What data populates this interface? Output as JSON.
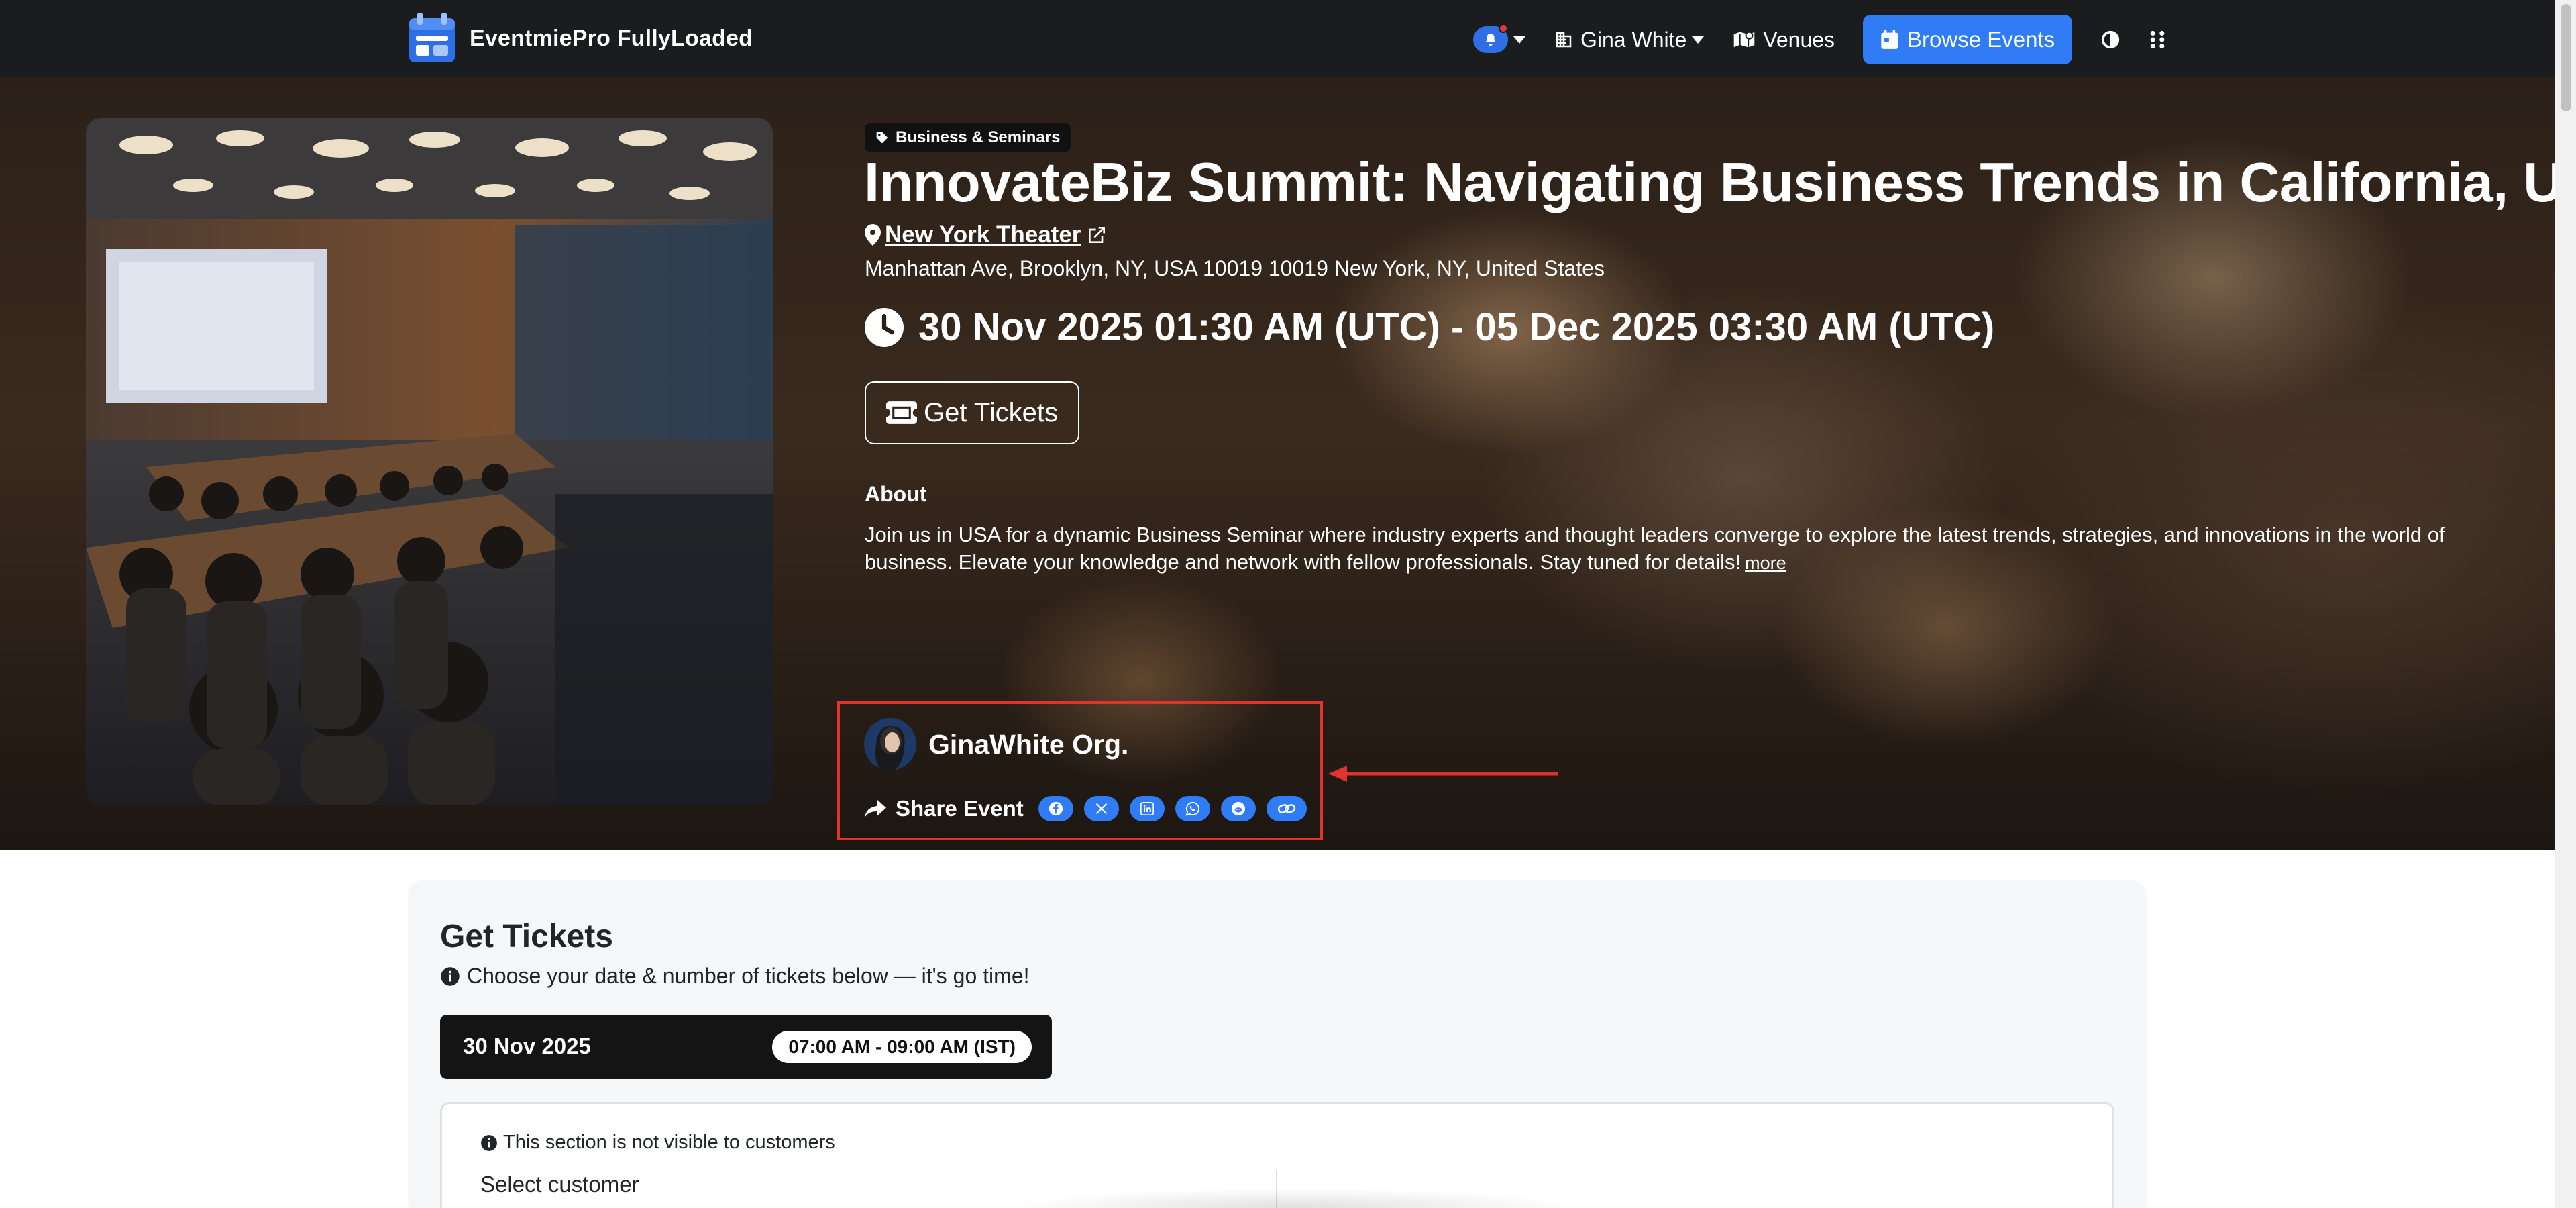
{
  "navbar": {
    "brand": "EventmiePro FullyLoaded",
    "user_name": "Gina White",
    "venues_label": "Venues",
    "browse_label": "Browse Events"
  },
  "event": {
    "category": "Business & Seminars",
    "title": "InnovateBiz Summit: Navigating Business Trends in California, USA",
    "venue_name": "New York Theater",
    "venue_address": "Manhattan Ave, Brooklyn, NY, USA 10019 10019 New York, NY, United States",
    "date_range": "30 Nov 2025 01:30 AM (UTC) - 05 Dec 2025 03:30 AM (UTC)",
    "get_tickets_label": "Get Tickets",
    "about_heading": "About",
    "about_text": "Join us in USA for a dynamic Business Seminar where industry experts and thought leaders converge to explore the latest trends, strategies, and innovations in the world of business. Elevate your knowledge and network with fellow professionals. Stay tuned for details!",
    "more_label": "more"
  },
  "organizer": {
    "name": "GinaWhite Org.",
    "share_label": "Share Event",
    "share_icons": [
      "facebook-icon",
      "x-icon",
      "linkedin-icon",
      "whatsapp-icon",
      "reddit-icon",
      "link-icon"
    ]
  },
  "tickets": {
    "heading": "Get Tickets",
    "subtitle": "Choose your date & number of tickets below — it's go time!",
    "date": "30 Nov 2025",
    "time": "07:00 AM - 09:00 AM (IST)",
    "note": "This section is not visible to customers",
    "select_customer": "Select customer"
  },
  "colors": {
    "navbar_bg": "#1b1c1e",
    "accent_blue": "#2f7cf6",
    "highlight_red": "#e0332e"
  }
}
